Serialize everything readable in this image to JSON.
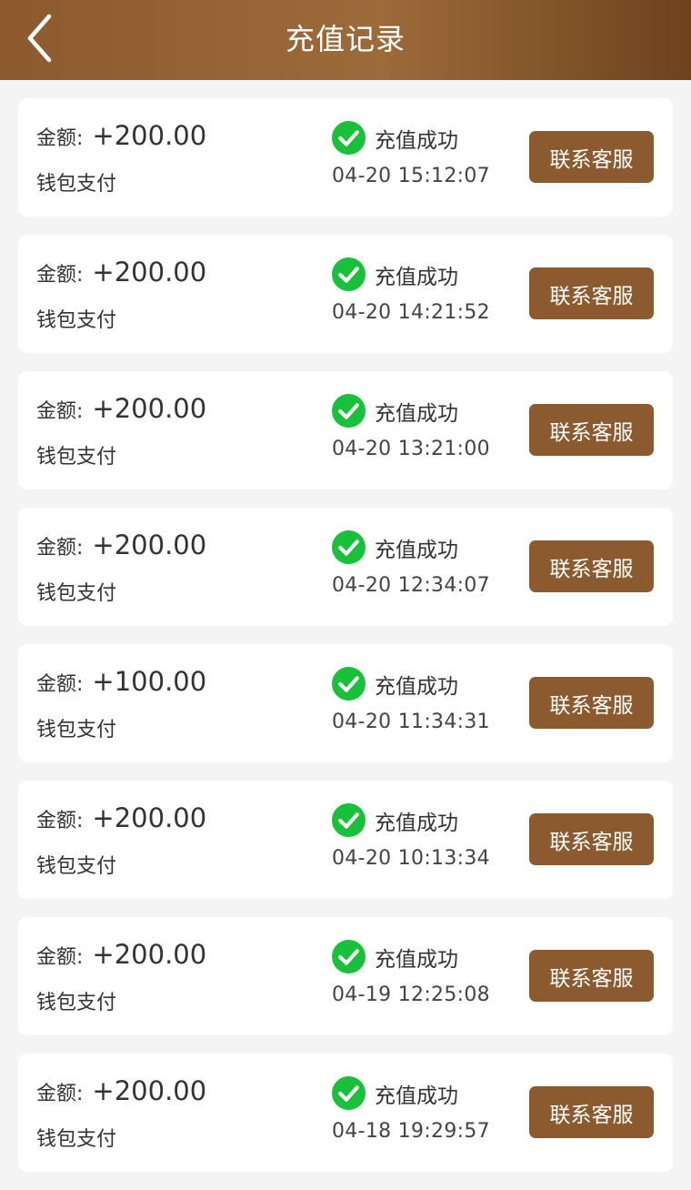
{
  "header": {
    "title": "充值记录",
    "back_icon": "chevron-left-icon"
  },
  "colors": {
    "header_brown": "#8c5a2d",
    "button_brown": "#8b5a2e",
    "success_green": "#19c13b",
    "background": "#f4f4f4"
  },
  "records": [
    {
      "amount_label": "金额:",
      "amount": "+200.00",
      "method": "钱包支付",
      "status": "充值成功",
      "time": "04-20 15:12:07",
      "button": "联系客服"
    },
    {
      "amount_label": "金额:",
      "amount": "+200.00",
      "method": "钱包支付",
      "status": "充值成功",
      "time": "04-20 14:21:52",
      "button": "联系客服"
    },
    {
      "amount_label": "金额:",
      "amount": "+200.00",
      "method": "钱包支付",
      "status": "充值成功",
      "time": "04-20 13:21:00",
      "button": "联系客服"
    },
    {
      "amount_label": "金额:",
      "amount": "+200.00",
      "method": "钱包支付",
      "status": "充值成功",
      "time": "04-20 12:34:07",
      "button": "联系客服"
    },
    {
      "amount_label": "金额:",
      "amount": "+100.00",
      "method": "钱包支付",
      "status": "充值成功",
      "time": "04-20 11:34:31",
      "button": "联系客服"
    },
    {
      "amount_label": "金额:",
      "amount": "+200.00",
      "method": "钱包支付",
      "status": "充值成功",
      "time": "04-20 10:13:34",
      "button": "联系客服"
    },
    {
      "amount_label": "金额:",
      "amount": "+200.00",
      "method": "钱包支付",
      "status": "充值成功",
      "time": "04-19 12:25:08",
      "button": "联系客服"
    },
    {
      "amount_label": "金额:",
      "amount": "+200.00",
      "method": "钱包支付",
      "status": "充值成功",
      "time": "04-18 19:29:57",
      "button": "联系客服"
    }
  ]
}
